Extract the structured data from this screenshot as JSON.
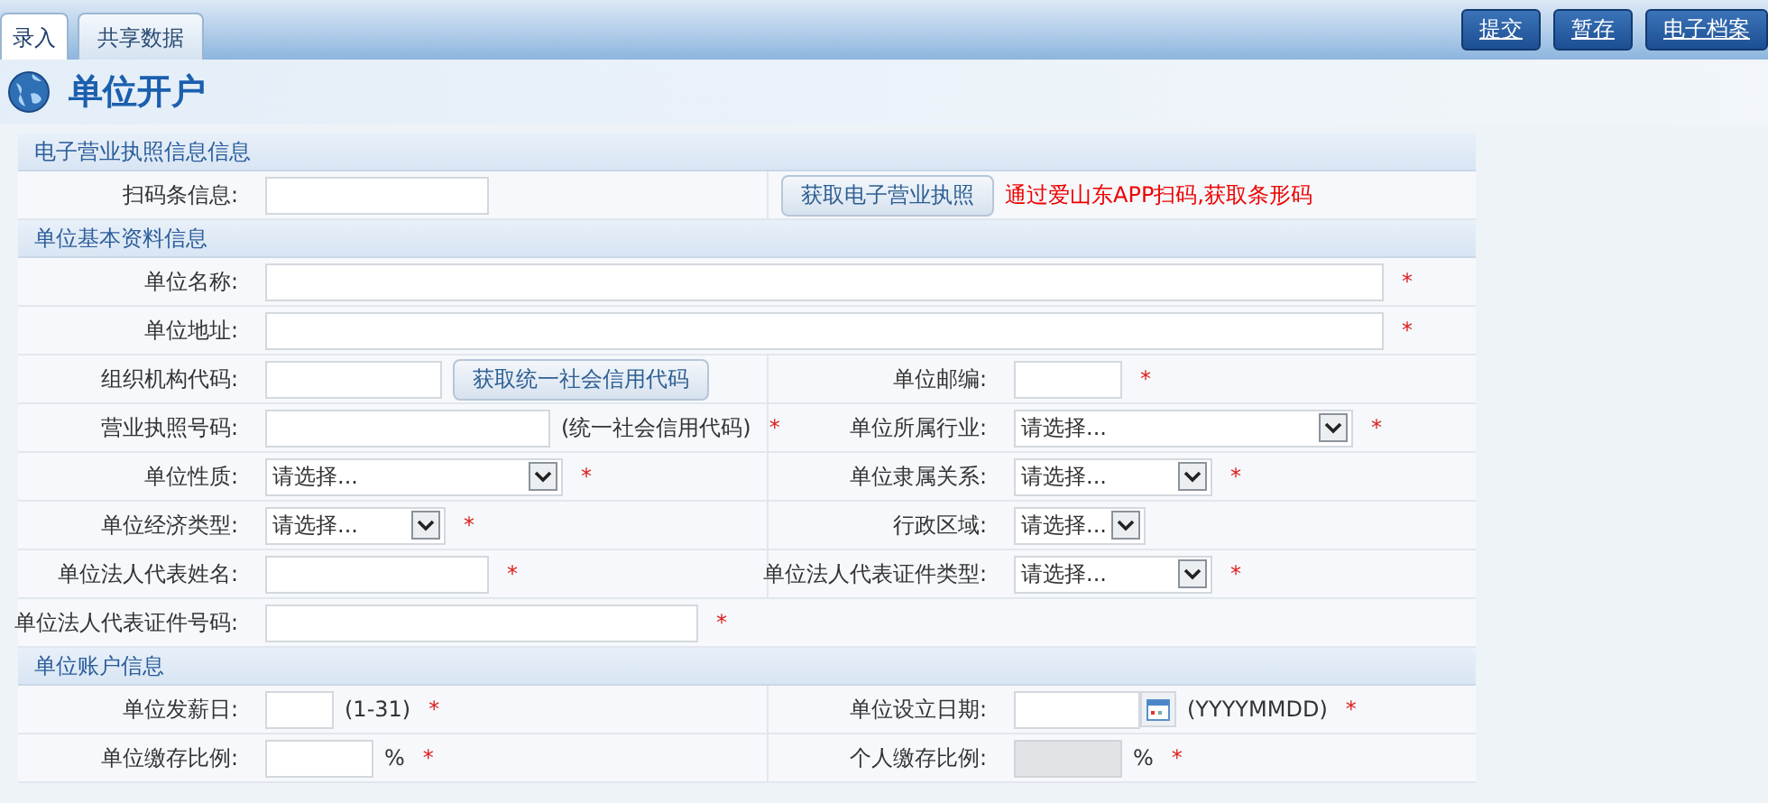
{
  "tabs": [
    {
      "label": "录入",
      "selected": true
    },
    {
      "label": "共享数据",
      "selected": false
    }
  ],
  "toolbar": {
    "buttons": [
      "提交",
      "暂存",
      "电子档案"
    ]
  },
  "page_title": "单位开户",
  "sections": [
    {
      "title": "电子营业执照信息信息",
      "rows": [
        {
          "kind": "pair",
          "cells": [
            {
              "label": "扫码条信息:",
              "control": {
                "kind": "text"
              }
            },
            {
              "button": "获取电子营业执照",
              "note": "通过爱山东APP扫码,获取条形码"
            }
          ]
        }
      ]
    },
    {
      "title": "单位基本资料信息",
      "rows": [
        {
          "kind": "single",
          "cells": [
            {
              "label": "单位名称:",
              "control": {
                "kind": "text"
              },
              "required_mark": "*"
            }
          ]
        },
        {
          "kind": "single",
          "cells": [
            {
              "label": "单位地址:",
              "control": {
                "kind": "text"
              },
              "required_mark": "*"
            }
          ]
        },
        {
          "kind": "pair",
          "cells": [
            {
              "label": "组织机构代码:",
              "control": {
                "kind": "text"
              },
              "button": "获取统一社会信用代码"
            },
            {
              "label": "单位邮编:",
              "control": {
                "kind": "text"
              },
              "required_mark": "*"
            }
          ]
        },
        {
          "kind": "pair",
          "cells": [
            {
              "label": "营业执照号码:",
              "control": {
                "kind": "text"
              },
              "suffix": "(统一社会信用代码)",
              "required_mark": "*"
            },
            {
              "label": "单位所属行业:",
              "control": {
                "kind": "select",
                "value": "请选择..."
              },
              "required_mark": "*"
            }
          ]
        },
        {
          "kind": "pair",
          "cells": [
            {
              "label": "单位性质:",
              "control": {
                "kind": "select",
                "value": "请选择..."
              },
              "required_mark": "*"
            },
            {
              "label": "单位隶属关系:",
              "control": {
                "kind": "select",
                "value": "请选择..."
              },
              "required_mark": "*"
            }
          ]
        },
        {
          "kind": "pair",
          "cells": [
            {
              "label": "单位经济类型:",
              "control": {
                "kind": "select",
                "value": "请选择..."
              },
              "required_mark": "*"
            },
            {
              "label": "行政区域:",
              "control": {
                "kind": "select",
                "value": "请选择..."
              }
            }
          ]
        },
        {
          "kind": "pair",
          "cells": [
            {
              "label": "单位法人代表姓名:",
              "control": {
                "kind": "text"
              },
              "required_mark": "*"
            },
            {
              "label": "单位法人代表证件类型:",
              "control": {
                "kind": "select",
                "value": "请选择..."
              },
              "required_mark": "*"
            }
          ]
        },
        {
          "kind": "single",
          "cells": [
            {
              "label": "单位法人代表证件号码:",
              "control": {
                "kind": "text"
              },
              "required_mark": "*"
            }
          ]
        }
      ]
    },
    {
      "title": "单位账户信息",
      "rows": [
        {
          "kind": "pair",
          "cells": [
            {
              "label": "单位发薪日:",
              "control": {
                "kind": "text"
              },
              "suffix": "(1-31)",
              "required_mark": "*"
            },
            {
              "label": "单位设立日期:",
              "control": {
                "kind": "date"
              },
              "suffix": "(YYYYMMDD)",
              "required_mark": "*"
            }
          ]
        },
        {
          "kind": "pair",
          "cells": [
            {
              "label": "单位缴存比例:",
              "control": {
                "kind": "text",
                "disabled": false
              },
              "suffix": "%",
              "required_mark": "*"
            },
            {
              "label": "个人缴存比例:",
              "control": {
                "kind": "text",
                "disabled": true
              },
              "suffix": "%",
              "required_mark": "*"
            }
          ]
        }
      ]
    }
  ]
}
